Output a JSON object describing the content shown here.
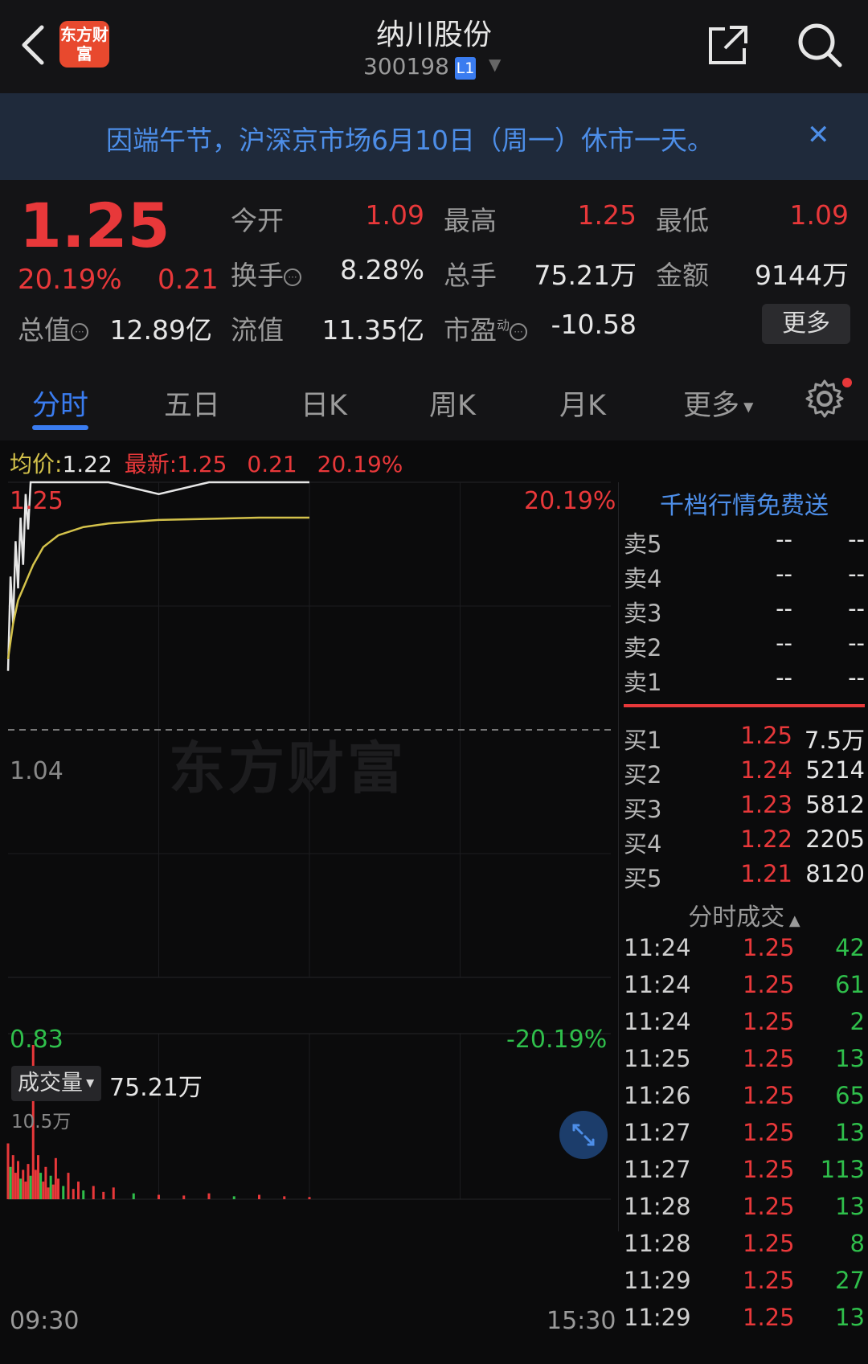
{
  "header": {
    "app_logo_text": "东方财富",
    "stock_name": "纳川股份",
    "stock_code": "300198",
    "level_badge": "L1"
  },
  "notice": {
    "text": "因端午节，沪深京市场6月10日（周一）休市一天。",
    "close_glyph": "✕"
  },
  "quote": {
    "price": "1.25",
    "change_pct": "20.19%",
    "change": "0.21",
    "fields": {
      "open_label": "今开",
      "open": "1.09",
      "high_label": "最高",
      "high": "1.25",
      "low_label": "最低",
      "low": "1.09",
      "turnover_label": "换手",
      "turnover": "8.28%",
      "volume_label": "总手",
      "volume": "75.21万",
      "amount_label": "金额",
      "amount": "9144万",
      "mktcap_label": "总值",
      "mktcap": "12.89亿",
      "float_label": "流值",
      "float_cap": "11.35亿",
      "pe_label": "市盈",
      "pe_sup": "动",
      "pe": "-10.58"
    },
    "more_label": "更多"
  },
  "tabs": [
    "分时",
    "五日",
    "日K",
    "周K",
    "月K",
    "更多"
  ],
  "active_tab": 0,
  "chart": {
    "avg_label": "均价:",
    "avg_value": "1.22",
    "latest_label": "最新:",
    "latest_value": "1.25",
    "latest_change": "0.21",
    "latest_pct": "20.19%",
    "top_price": "1.25",
    "top_pct": "20.19%",
    "mid_price": "1.04",
    "bottom_price": "0.83",
    "bottom_pct": "-20.19%",
    "watermark": "东方财富",
    "volume_selector": "成交量",
    "volume_total": "75.21万",
    "volume_max": "10.5万",
    "time_start": "09:30",
    "time_end": "15:30"
  },
  "chart_data": {
    "type": "line",
    "title": "",
    "ylim": [
      0.83,
      1.25
    ],
    "reference": 1.04,
    "series": [
      {
        "color": "#e6e6e6",
        "x": [
          0,
          1,
          2,
          3,
          4,
          5,
          6,
          7,
          8,
          9,
          10,
          12,
          14,
          20,
          30,
          40,
          60,
          80,
          100,
          120
        ],
        "values": [
          1.09,
          1.17,
          1.13,
          1.2,
          1.16,
          1.22,
          1.18,
          1.24,
          1.21,
          1.25,
          1.25,
          1.25,
          1.25,
          1.25,
          1.25,
          1.25,
          1.24,
          1.25,
          1.25,
          1.25
        ]
      },
      {
        "color": "#d4c24b",
        "x": [
          0,
          2,
          4,
          6,
          8,
          10,
          14,
          20,
          30,
          40,
          60,
          80,
          100,
          120
        ],
        "values": [
          1.1,
          1.13,
          1.15,
          1.16,
          1.17,
          1.18,
          1.195,
          1.205,
          1.212,
          1.215,
          1.218,
          1.219,
          1.22,
          1.22
        ]
      }
    ],
    "volume": {
      "ymax": 105000,
      "x": [
        0,
        1,
        2,
        3,
        4,
        5,
        6,
        7,
        8,
        9,
        10,
        11,
        12,
        13,
        14,
        15,
        16,
        17,
        18,
        19,
        20,
        22,
        24,
        26,
        28,
        30,
        34,
        38,
        42,
        50,
        60,
        70,
        80,
        90,
        100,
        110,
        120
      ],
      "values": [
        38000,
        22000,
        30000,
        18000,
        26000,
        14000,
        20000,
        12000,
        24000,
        16000,
        105000,
        20000,
        30000,
        18000,
        12000,
        22000,
        8000,
        16000,
        10000,
        28000,
        14000,
        9000,
        18000,
        7000,
        12000,
        6000,
        9000,
        5000,
        8000,
        4000,
        3000,
        2500,
        4000,
        2000,
        3000,
        2000,
        1500
      ]
    }
  },
  "order_book": {
    "promo": "千档行情免费送",
    "asks": [
      {
        "label": "卖5",
        "price": "--",
        "vol": "--"
      },
      {
        "label": "卖4",
        "price": "--",
        "vol": "--"
      },
      {
        "label": "卖3",
        "price": "--",
        "vol": "--"
      },
      {
        "label": "卖2",
        "price": "--",
        "vol": "--"
      },
      {
        "label": "卖1",
        "price": "--",
        "vol": "--"
      }
    ],
    "bids": [
      {
        "label": "买1",
        "price": "1.25",
        "vol": "7.5万"
      },
      {
        "label": "买2",
        "price": "1.24",
        "vol": "5214"
      },
      {
        "label": "买3",
        "price": "1.23",
        "vol": "5812"
      },
      {
        "label": "买4",
        "price": "1.22",
        "vol": "2205"
      },
      {
        "label": "买5",
        "price": "1.21",
        "vol": "8120"
      }
    ],
    "ticks_header": "分时成交",
    "ticks": [
      {
        "time": "11:24",
        "price": "1.25",
        "vol": "42"
      },
      {
        "time": "11:24",
        "price": "1.25",
        "vol": "61"
      },
      {
        "time": "11:24",
        "price": "1.25",
        "vol": "2"
      },
      {
        "time": "11:25",
        "price": "1.25",
        "vol": "13"
      },
      {
        "time": "11:26",
        "price": "1.25",
        "vol": "65"
      },
      {
        "time": "11:27",
        "price": "1.25",
        "vol": "13"
      },
      {
        "time": "11:27",
        "price": "1.25",
        "vol": "113"
      },
      {
        "time": "11:28",
        "price": "1.25",
        "vol": "13"
      },
      {
        "time": "11:28",
        "price": "1.25",
        "vol": "8"
      },
      {
        "time": "11:29",
        "price": "1.25",
        "vol": "27"
      },
      {
        "time": "11:29",
        "price": "1.25",
        "vol": "13"
      }
    ]
  },
  "colors": {
    "up": "#e8383a",
    "down": "#2fbf4b",
    "accent": "#3a7cf0",
    "avg_line": "#d4c24b"
  }
}
